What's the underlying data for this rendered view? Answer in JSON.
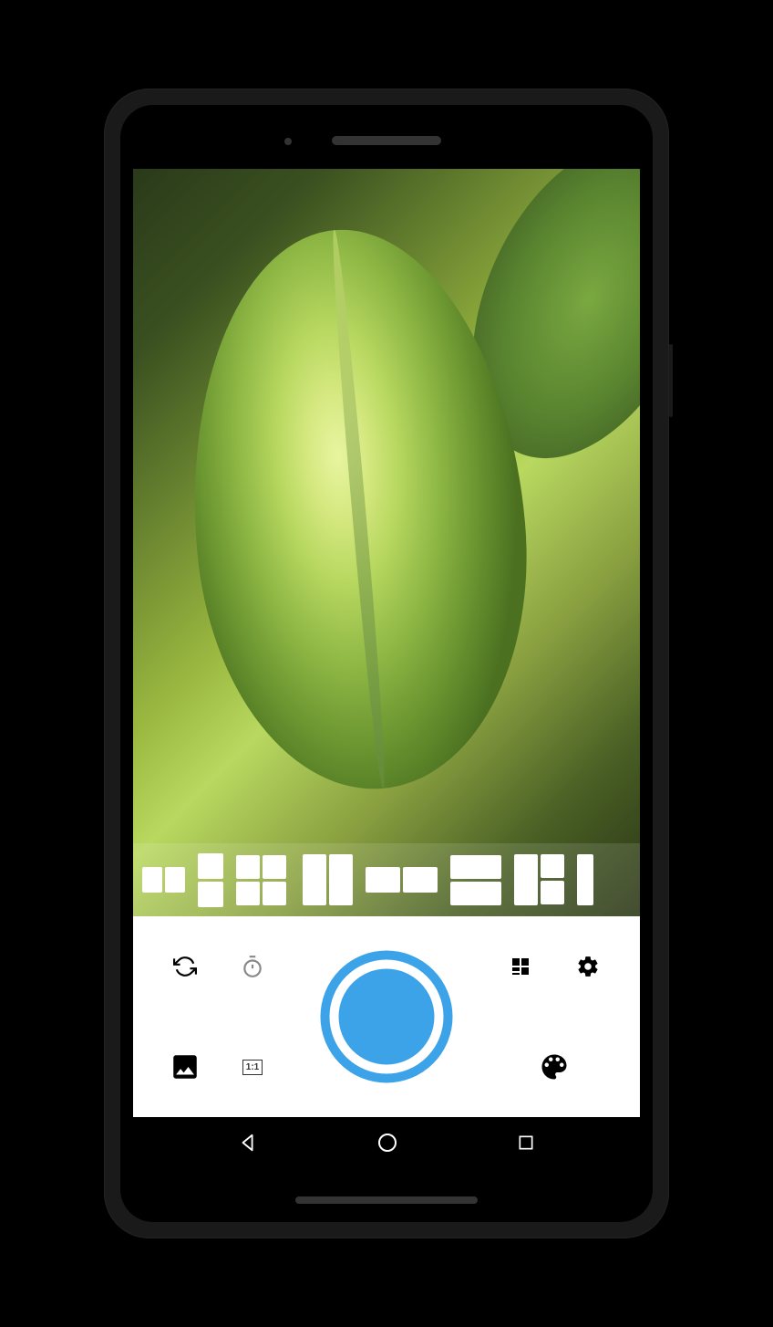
{
  "viewfinder": {
    "subject": "green-leaf-plant"
  },
  "layouts": {
    "options": [
      {
        "id": "half-square",
        "type": "2col-short"
      },
      {
        "id": "2row",
        "type": "2row"
      },
      {
        "id": "2x2",
        "type": "grid-2x2"
      },
      {
        "id": "2col-tall",
        "type": "2col-tall"
      },
      {
        "id": "2col-wide",
        "type": "2col-wide-short"
      },
      {
        "id": "2row-wide",
        "type": "2row-wide"
      },
      {
        "id": "3cell",
        "type": "1-2-split"
      },
      {
        "id": "partial",
        "type": "partial"
      }
    ]
  },
  "controls": {
    "top_left": [
      {
        "name": "switch-camera",
        "icon": "refresh"
      },
      {
        "name": "timer",
        "icon": "timer"
      }
    ],
    "top_right": [
      {
        "name": "layout-grid",
        "icon": "grid"
      },
      {
        "name": "settings",
        "icon": "gear"
      }
    ],
    "bottom_left": [
      {
        "name": "gallery",
        "icon": "image"
      },
      {
        "name": "aspect-ratio",
        "label": "1:1"
      }
    ],
    "bottom_right": [
      {
        "name": "color-palette",
        "icon": "palette"
      }
    ],
    "shutter_color": "#3ca3e8"
  },
  "navbar": {
    "buttons": [
      "back",
      "home",
      "recent"
    ]
  }
}
